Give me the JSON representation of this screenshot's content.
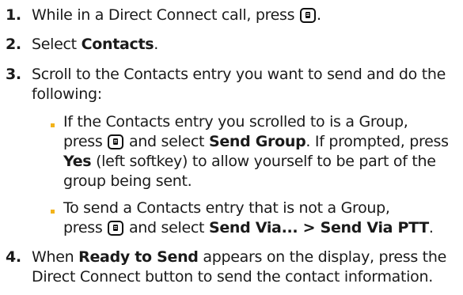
{
  "steps": [
    {
      "number": "1.",
      "text": "While in a Direct Connect call, press",
      "text_end": "."
    },
    {
      "number": "2.",
      "text": "Select",
      "bold": "Contacts",
      "text_end": "."
    },
    {
      "number": "3.",
      "line1": "Scroll to the Contacts entry you want to send and do the",
      "line2": "following:"
    },
    {
      "number": "4.",
      "l1a": "When",
      "l1b": "Ready to Send",
      "l1c": "appears on the display, press the",
      "line2": "Direct Connect button to send the contact information."
    }
  ],
  "bullets": [
    {
      "l1": "If the Contacts entry you scrolled to is a Group,",
      "l2a": "press",
      "l2b": "and select",
      "l2c": "Send Group",
      "l2d": ". If prompted, press",
      "l3a": "Yes",
      "l3b": "(left softkey) to allow yourself to be part of the",
      "l4": "group being sent."
    },
    {
      "l1": "To send a Contacts entry that is not a Group,",
      "l2a": "press",
      "l2b": "and select",
      "l2c": "Send Via... > Send Via PTT",
      "l2d": "."
    }
  ],
  "icons": {
    "menu_key": "menu-ok-key-icon"
  },
  "colors": {
    "bullet": "#f3b31a",
    "text": "#1a1a1a"
  }
}
